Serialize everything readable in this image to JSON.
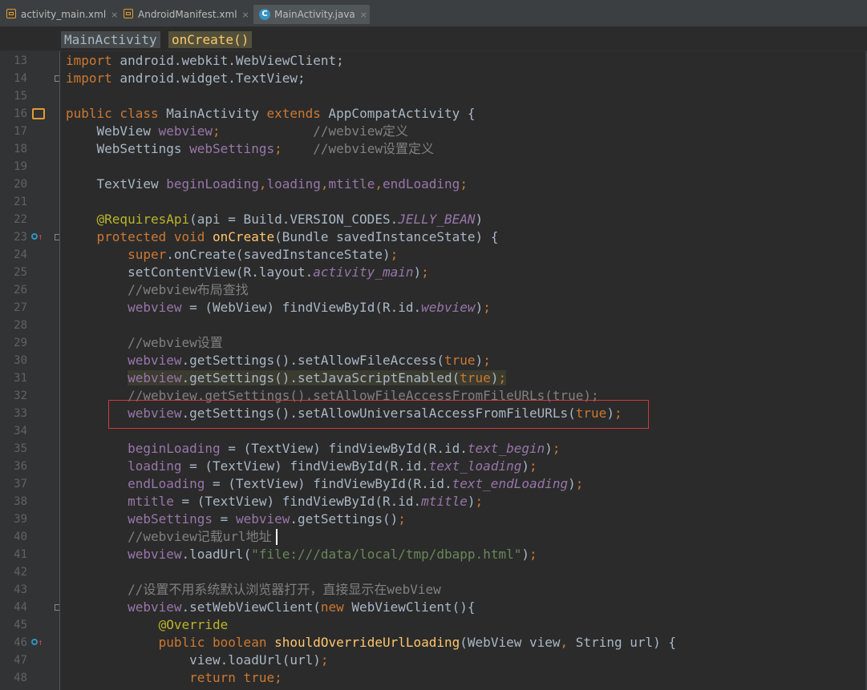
{
  "tabs": [
    {
      "label": "activity_main.xml",
      "close": "×",
      "icon": "layout-file-icon"
    },
    {
      "label": "AndroidManifest.xml",
      "close": "×",
      "icon": "layout-file-icon"
    },
    {
      "label": "MainActivity.java",
      "close": "×",
      "icon": "java-class-icon",
      "icon_glyph": "C"
    }
  ],
  "breadcrumb": {
    "class": "MainActivity",
    "method": "onCreate()"
  },
  "lines": [
    {
      "num": "13",
      "parts": [
        {
          "c": "kw",
          "t": "import"
        },
        {
          "c": "plain",
          "t": " android.webkit.WebViewClient;"
        }
      ]
    },
    {
      "num": "14",
      "parts": [
        {
          "c": "kw",
          "t": "import"
        },
        {
          "c": "plain",
          "t": " android.widget.TextView;"
        }
      ]
    },
    {
      "num": "15",
      "parts": []
    },
    {
      "num": "16",
      "parts": [
        {
          "c": "kw",
          "t": "public class "
        },
        {
          "c": "plain",
          "t": "MainActivity "
        },
        {
          "c": "kw",
          "t": "extends "
        },
        {
          "c": "plain",
          "t": "AppCompatActivity {"
        }
      ]
    },
    {
      "num": "17",
      "parts": [
        {
          "c": "plain",
          "t": "    WebView "
        },
        {
          "c": "var",
          "t": "webview"
        },
        {
          "c": "kw",
          "t": ";"
        },
        {
          "c": "plain",
          "t": "            "
        },
        {
          "c": "com",
          "t": "//webview定义"
        }
      ]
    },
    {
      "num": "18",
      "parts": [
        {
          "c": "plain",
          "t": "    WebSettings "
        },
        {
          "c": "var",
          "t": "webSettings"
        },
        {
          "c": "kw",
          "t": ";"
        },
        {
          "c": "plain",
          "t": "    "
        },
        {
          "c": "com",
          "t": "//webview设置定义"
        }
      ]
    },
    {
      "num": "19",
      "parts": []
    },
    {
      "num": "20",
      "parts": [
        {
          "c": "plain",
          "t": "    TextView "
        },
        {
          "c": "var",
          "t": "beginLoading"
        },
        {
          "c": "kw",
          "t": ","
        },
        {
          "c": "var",
          "t": "loading"
        },
        {
          "c": "kw",
          "t": ","
        },
        {
          "c": "var",
          "t": "mtitle"
        },
        {
          "c": "kw",
          "t": ","
        },
        {
          "c": "var",
          "t": "endLoading"
        },
        {
          "c": "kw",
          "t": ";"
        }
      ]
    },
    {
      "num": "21",
      "parts": []
    },
    {
      "num": "22",
      "parts": [
        {
          "c": "plain",
          "t": "    "
        },
        {
          "c": "ann",
          "t": "@RequiresApi"
        },
        {
          "c": "plain",
          "t": "(api = Build.VERSION_CODES."
        },
        {
          "c": "ital",
          "t": "JELLY_BEAN"
        },
        {
          "c": "plain",
          "t": ")"
        }
      ]
    },
    {
      "num": "23",
      "parts": [
        {
          "c": "plain",
          "t": "    "
        },
        {
          "c": "kw",
          "t": "protected void "
        },
        {
          "c": "fn",
          "t": "onCreate"
        },
        {
          "c": "plain",
          "t": "(Bundle savedInstanceState) {"
        }
      ]
    },
    {
      "num": "24",
      "parts": [
        {
          "c": "plain",
          "t": "        "
        },
        {
          "c": "kw",
          "t": "super"
        },
        {
          "c": "plain",
          "t": ".onCreate(savedInstanceState)"
        },
        {
          "c": "kw",
          "t": ";"
        }
      ]
    },
    {
      "num": "25",
      "parts": [
        {
          "c": "plain",
          "t": "        setContentView(R.layout."
        },
        {
          "c": "ital",
          "t": "activity_main"
        },
        {
          "c": "plain",
          "t": ")"
        },
        {
          "c": "kw",
          "t": ";"
        }
      ]
    },
    {
      "num": "26",
      "parts": [
        {
          "c": "com",
          "t": "        //webview布局查找"
        }
      ]
    },
    {
      "num": "27",
      "parts": [
        {
          "c": "plain",
          "t": "        "
        },
        {
          "c": "var",
          "t": "webview"
        },
        {
          "c": "plain",
          "t": " = (WebView) findViewById(R.id."
        },
        {
          "c": "ital",
          "t": "webview"
        },
        {
          "c": "plain",
          "t": ")"
        },
        {
          "c": "kw",
          "t": ";"
        }
      ]
    },
    {
      "num": "28",
      "parts": []
    },
    {
      "num": "29",
      "parts": [
        {
          "c": "com",
          "t": "        //webview设置"
        }
      ]
    },
    {
      "num": "30",
      "parts": [
        {
          "c": "plain",
          "t": "        "
        },
        {
          "c": "var",
          "t": "webview"
        },
        {
          "c": "plain",
          "t": ".getSettings().setAllowFileAccess("
        },
        {
          "c": "kw",
          "t": "true"
        },
        {
          "c": "plain",
          "t": ")"
        },
        {
          "c": "kw",
          "t": ";"
        }
      ]
    },
    {
      "num": "31",
      "hl": true,
      "parts": [
        {
          "c": "plain",
          "t": "        "
        },
        {
          "c": "var",
          "t": "webview"
        },
        {
          "c": "plain",
          "t": ".getSettings().setJavaScriptEnabled("
        },
        {
          "c": "kw",
          "t": "true"
        },
        {
          "c": "plain",
          "t": ")"
        },
        {
          "c": "kw",
          "t": ";"
        }
      ]
    },
    {
      "num": "32",
      "parts": [
        {
          "c": "com",
          "t": "        //webview.getSettings().setAllowFileAccessFromFileURLs(true);"
        }
      ]
    },
    {
      "num": "33",
      "parts": [
        {
          "c": "plain",
          "t": "        "
        },
        {
          "c": "var",
          "t": "webview"
        },
        {
          "c": "plain",
          "t": ".getSettings().setAllowUniversalAccessFromFileURLs("
        },
        {
          "c": "kw",
          "t": "true"
        },
        {
          "c": "plain",
          "t": ")"
        },
        {
          "c": "kw",
          "t": ";"
        }
      ]
    },
    {
      "num": "34",
      "parts": []
    },
    {
      "num": "35",
      "parts": [
        {
          "c": "plain",
          "t": "        "
        },
        {
          "c": "var",
          "t": "beginLoading"
        },
        {
          "c": "plain",
          "t": " = (TextView) findViewById(R.id."
        },
        {
          "c": "ital",
          "t": "text_begin"
        },
        {
          "c": "plain",
          "t": ")"
        },
        {
          "c": "kw",
          "t": ";"
        }
      ]
    },
    {
      "num": "36",
      "parts": [
        {
          "c": "plain",
          "t": "        "
        },
        {
          "c": "var",
          "t": "loading"
        },
        {
          "c": "plain",
          "t": " = (TextView) findViewById(R.id."
        },
        {
          "c": "ital",
          "t": "text_loading"
        },
        {
          "c": "plain",
          "t": ")"
        },
        {
          "c": "kw",
          "t": ";"
        }
      ]
    },
    {
      "num": "37",
      "parts": [
        {
          "c": "plain",
          "t": "        "
        },
        {
          "c": "var",
          "t": "endLoading"
        },
        {
          "c": "plain",
          "t": " = (TextView) findViewById(R.id."
        },
        {
          "c": "ital",
          "t": "text_endLoading"
        },
        {
          "c": "plain",
          "t": ")"
        },
        {
          "c": "kw",
          "t": ";"
        }
      ]
    },
    {
      "num": "38",
      "parts": [
        {
          "c": "plain",
          "t": "        "
        },
        {
          "c": "var",
          "t": "mtitle"
        },
        {
          "c": "plain",
          "t": " = (TextView) findViewById(R.id."
        },
        {
          "c": "ital",
          "t": "mtitle"
        },
        {
          "c": "plain",
          "t": ")"
        },
        {
          "c": "kw",
          "t": ";"
        }
      ]
    },
    {
      "num": "39",
      "parts": [
        {
          "c": "plain",
          "t": "        "
        },
        {
          "c": "var",
          "t": "webSettings"
        },
        {
          "c": "plain",
          "t": " = "
        },
        {
          "c": "var",
          "t": "webview"
        },
        {
          "c": "plain",
          "t": ".getSettings()"
        },
        {
          "c": "kw",
          "t": ";"
        }
      ]
    },
    {
      "num": "40",
      "parts": [
        {
          "c": "com",
          "t": "        //webview记载url地址"
        }
      ]
    },
    {
      "num": "41",
      "parts": [
        {
          "c": "plain",
          "t": "        "
        },
        {
          "c": "var",
          "t": "webview"
        },
        {
          "c": "plain",
          "t": ".loadUrl("
        },
        {
          "c": "str",
          "t": "\"file:///data/local/tmp/dbapp.html\""
        },
        {
          "c": "plain",
          "t": ")"
        },
        {
          "c": "kw",
          "t": ";"
        }
      ]
    },
    {
      "num": "42",
      "parts": []
    },
    {
      "num": "43",
      "parts": [
        {
          "c": "com",
          "t": "        //设置不用系统默认浏览器打开，直接显示在webView"
        }
      ]
    },
    {
      "num": "44",
      "parts": [
        {
          "c": "plain",
          "t": "        "
        },
        {
          "c": "var",
          "t": "webview"
        },
        {
          "c": "plain",
          "t": ".setWebViewClient("
        },
        {
          "c": "kw",
          "t": "new "
        },
        {
          "c": "plain",
          "t": "WebViewClient(){"
        }
      ]
    },
    {
      "num": "45",
      "parts": [
        {
          "c": "plain",
          "t": "            "
        },
        {
          "c": "ann",
          "t": "@Override"
        }
      ]
    },
    {
      "num": "46",
      "parts": [
        {
          "c": "plain",
          "t": "            "
        },
        {
          "c": "kw",
          "t": "public boolean "
        },
        {
          "c": "fn",
          "t": "shouldOverrideUrlLoading"
        },
        {
          "c": "plain",
          "t": "(WebView view"
        },
        {
          "c": "kw",
          "t": ", "
        },
        {
          "c": "plain",
          "t": "String url) {"
        }
      ]
    },
    {
      "num": "47",
      "parts": [
        {
          "c": "plain",
          "t": "                view.loadUrl(url)"
        },
        {
          "c": "kw",
          "t": ";"
        }
      ]
    },
    {
      "num": "48",
      "parts": [
        {
          "c": "plain",
          "t": "                "
        },
        {
          "c": "kw",
          "t": "return true;"
        }
      ]
    }
  ],
  "gutter_markers": {
    "16": "android-activity-icon",
    "23": "override-method-icon",
    "46": "override-method-icon"
  },
  "fold_markers": [
    "14",
    "23",
    "44"
  ],
  "colors": {
    "background": "#2b2b2b",
    "keyword": "#cc7832",
    "method": "#ffc66d",
    "field": "#9876aa",
    "string": "#6a8759",
    "comment": "#808080",
    "annotation": "#bbb529",
    "highlight_box": "#d03a3a"
  }
}
